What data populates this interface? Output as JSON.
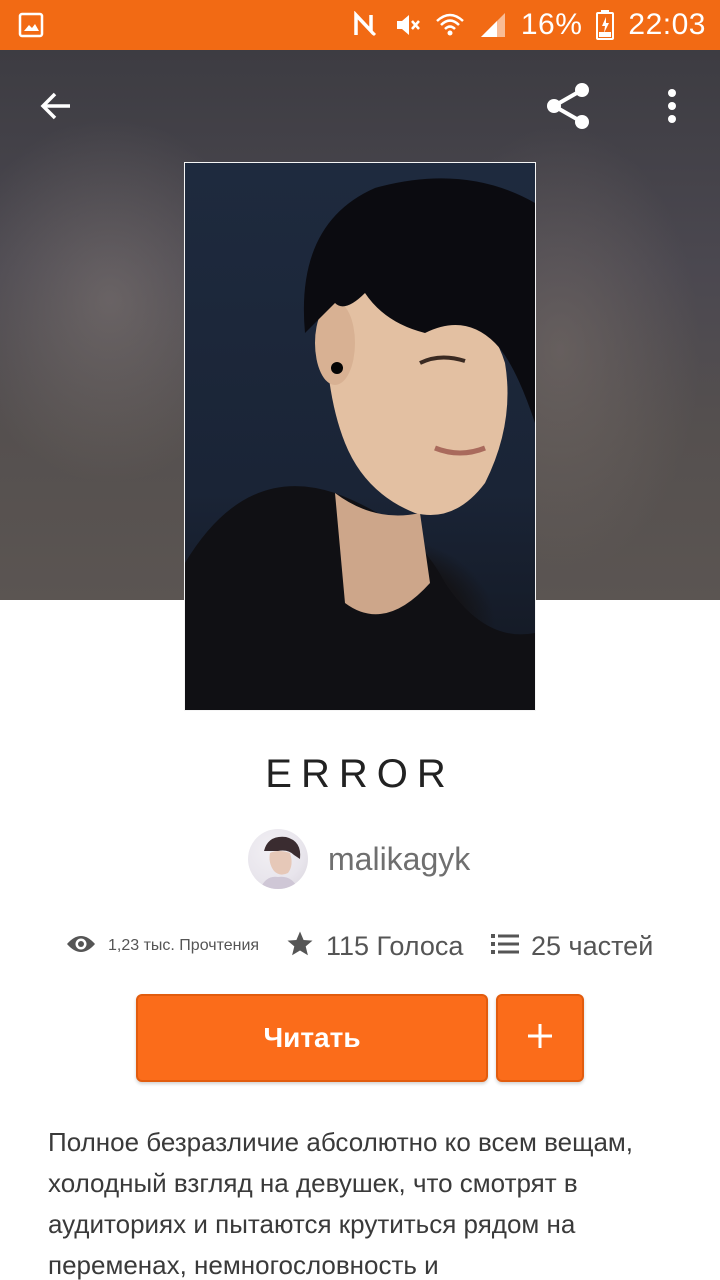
{
  "status_bar": {
    "battery": "16%",
    "time": "22:03",
    "icons": [
      "gallery-icon",
      "nfc-icon",
      "mute-icon",
      "wifi-icon",
      "signal-icon",
      "battery-charging-icon"
    ]
  },
  "toolbar": {
    "icons": [
      "back-arrow-icon",
      "share-icon",
      "more-vert-icon"
    ]
  },
  "story": {
    "title": "ERROR",
    "author": "malikagyk",
    "stats": {
      "reads": "1,23 тыс. Прочтения",
      "votes": "115 Голоса",
      "parts": "25 частей"
    },
    "read_label": "Читать",
    "add_label": "+",
    "description": "Полное безразличие абсолютно ко всем вещам, холодный взгляд на девушек, что смотрят в аудиториях и пытаются крутиться рядом на переменах, немногословность и"
  },
  "colors": {
    "accent": "#f26a14",
    "button": "#fb6c1a",
    "text_muted": "#6f6f6f"
  }
}
